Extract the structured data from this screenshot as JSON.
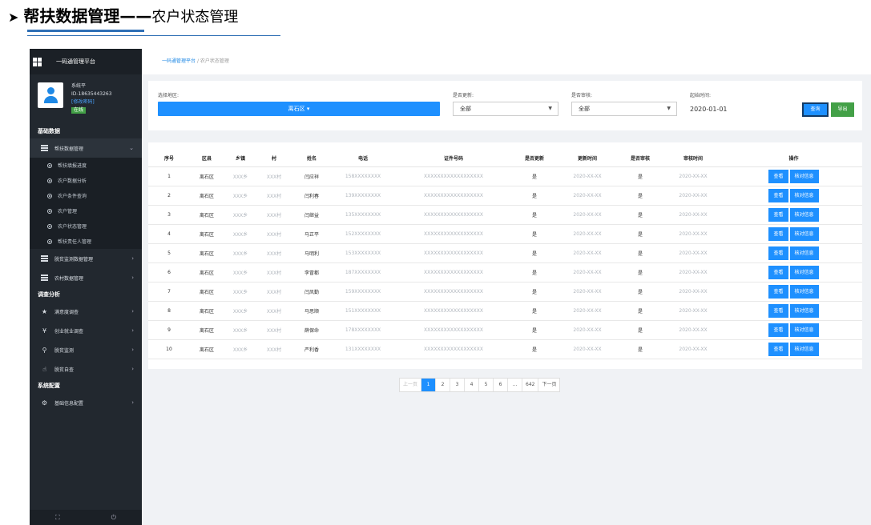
{
  "doc": {
    "arrow": "➤",
    "title_bold": "帮扶数据管理——",
    "title_rest": "农户状态管理"
  },
  "sidebar": {
    "brand": "一码通管理平台",
    "user": {
      "name": "系统平",
      "phone": "ID-18635443263",
      "change_password": "[修改密码]",
      "status": "在线"
    },
    "sections": {
      "basic": "基础数据",
      "survey": "调查分析",
      "config": "系统配置"
    },
    "groups": {
      "help_data": "帮扶数据管理",
      "poverty_monitor": "脱贫监测数据管理",
      "village_data": "农村数据管理",
      "satisfaction": "满意度调查",
      "employment": "创业就业调查",
      "monitor": "脱贫监测",
      "self_check": "脱贫自查",
      "basic_config": "基础信息配置"
    },
    "sub_items": [
      "帮扶填报进度",
      "农户数据分析",
      "农户条件查询",
      "农户管理",
      "农户状态管理",
      "帮扶责任人管理"
    ]
  },
  "breadcrumb": {
    "home": "一码通管理平台",
    "sep": "/",
    "current": "农户状态管理"
  },
  "filters": {
    "region_label": "选择地区:",
    "region_value": "离石区 ▾",
    "update_label": "是否更新:",
    "update_value": "全部",
    "audit_label": "是否审核:",
    "audit_value": "全部",
    "date_label": "起始时间:",
    "date_value": "2020-01-01",
    "query_btn": "查询",
    "export_btn": "导出"
  },
  "table": {
    "headers": [
      "序号",
      "区县",
      "乡镇",
      "村",
      "姓名",
      "电话",
      "证件号码",
      "是否更新",
      "更新时间",
      "是否审核",
      "审核时间",
      "操作"
    ],
    "rows": [
      {
        "no": "1",
        "county": "离石区",
        "town": "XXX乡",
        "village": "XXX村",
        "name": "闫应祥",
        "phone": "158XXXXXXXX",
        "id": "XXXXXXXXXXXXXXXXXX",
        "updated": "是",
        "update_time": "2020-XX-XX",
        "audited": "是",
        "audit_time": "2020-XX-XX"
      },
      {
        "no": "2",
        "county": "离石区",
        "town": "XXX乡",
        "village": "XXX村",
        "name": "闫利春",
        "phone": "139XXXXXXXX",
        "id": "XXXXXXXXXXXXXXXXXX",
        "updated": "是",
        "update_time": "2020-XX-XX",
        "audited": "是",
        "audit_time": "2020-XX-XX"
      },
      {
        "no": "3",
        "county": "离石区",
        "town": "XXX乡",
        "village": "XXX村",
        "name": "闫继益",
        "phone": "135XXXXXXXX",
        "id": "XXXXXXXXXXXXXXXXXX",
        "updated": "是",
        "update_time": "2020-XX-XX",
        "audited": "是",
        "audit_time": "2020-XX-XX"
      },
      {
        "no": "4",
        "county": "离石区",
        "town": "XXX乡",
        "village": "XXX村",
        "name": "马正平",
        "phone": "152XXXXXXXX",
        "id": "XXXXXXXXXXXXXXXXXX",
        "updated": "是",
        "update_time": "2020-XX-XX",
        "audited": "是",
        "audit_time": "2020-XX-XX"
      },
      {
        "no": "5",
        "county": "离石区",
        "town": "XXX乡",
        "village": "XXX村",
        "name": "马明利",
        "phone": "153XXXXXXXX",
        "id": "XXXXXXXXXXXXXXXXXX",
        "updated": "是",
        "update_time": "2020-XX-XX",
        "audited": "是",
        "audit_time": "2020-XX-XX"
      },
      {
        "no": "6",
        "county": "离石区",
        "town": "XXX乡",
        "village": "XXX村",
        "name": "李冒都",
        "phone": "187XXXXXXXX",
        "id": "XXXXXXXXXXXXXXXXXX",
        "updated": "是",
        "update_time": "2020-XX-XX",
        "audited": "是",
        "audit_time": "2020-XX-XX"
      },
      {
        "no": "7",
        "county": "离石区",
        "town": "XXX乡",
        "village": "XXX村",
        "name": "闫凤勤",
        "phone": "159XXXXXXXX",
        "id": "XXXXXXXXXXXXXXXXXX",
        "updated": "是",
        "update_time": "2020-XX-XX",
        "audited": "是",
        "audit_time": "2020-XX-XX"
      },
      {
        "no": "8",
        "county": "离石区",
        "town": "XXX乡",
        "village": "XXX村",
        "name": "马思顺",
        "phone": "151XXXXXXXX",
        "id": "XXXXXXXXXXXXXXXXXX",
        "updated": "是",
        "update_time": "2020-XX-XX",
        "audited": "是",
        "audit_time": "2020-XX-XX"
      },
      {
        "no": "9",
        "county": "离石区",
        "town": "XXX乡",
        "village": "XXX村",
        "name": "薛保命",
        "phone": "178XXXXXXXX",
        "id": "XXXXXXXXXXXXXXXXXX",
        "updated": "是",
        "update_time": "2020-XX-XX",
        "audited": "是",
        "audit_time": "2020-XX-XX"
      },
      {
        "no": "10",
        "county": "离石区",
        "town": "XXX乡",
        "village": "XXX村",
        "name": "严利香",
        "phone": "131XXXXXXXX",
        "id": "XXXXXXXXXXXXXXXXXX",
        "updated": "是",
        "update_time": "2020-XX-XX",
        "audited": "是",
        "audit_time": "2020-XX-XX"
      }
    ],
    "view_btn": "查看",
    "verify_btn": "核对信息"
  },
  "pager": {
    "prev": "上一页",
    "pages": [
      "1",
      "2",
      "3",
      "4",
      "5",
      "6",
      "...",
      "642"
    ],
    "next": "下一页",
    "active": "1"
  },
  "colors": {
    "primary": "#1e90ff",
    "sidebar": "#22282f",
    "success": "#43a047",
    "accent_rule": "#2f6fb5"
  }
}
